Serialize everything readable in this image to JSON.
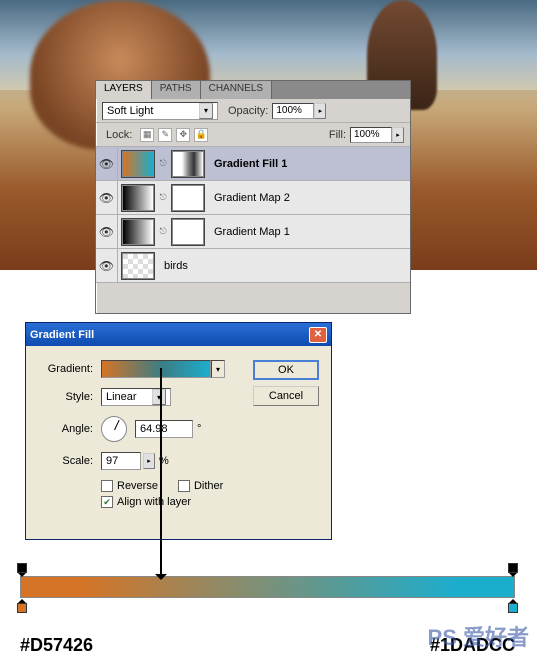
{
  "layers_panel": {
    "tabs": [
      "LAYERS",
      "PATHS",
      "CHANNELS"
    ],
    "active_tab": 0,
    "blend_mode": "Soft Light",
    "opacity_label": "Opacity:",
    "opacity_value": "100%",
    "lock_label": "Lock:",
    "fill_label": "Fill:",
    "fill_value": "100%",
    "layers": [
      {
        "name": "Gradient Fill 1",
        "selected": true,
        "bold": true,
        "thumb": "grad1",
        "mask": "mask-partial"
      },
      {
        "name": "Gradient Map 2",
        "selected": false,
        "bold": false,
        "thumb": "gradmap",
        "mask": "mask"
      },
      {
        "name": "Gradient Map 1",
        "selected": false,
        "bold": false,
        "thumb": "gradmap",
        "mask": "mask"
      },
      {
        "name": "birds",
        "selected": false,
        "bold": false,
        "thumb": "birds",
        "mask": null
      }
    ]
  },
  "gradient_fill": {
    "title": "Gradient Fill",
    "gradient_label": "Gradient:",
    "style_label": "Style:",
    "style_value": "Linear",
    "angle_label": "Angle:",
    "angle_value": "64.98",
    "angle_unit": "°",
    "scale_label": "Scale:",
    "scale_value": "97",
    "scale_unit": "%",
    "reverse_label": "Reverse",
    "dither_label": "Dither",
    "align_label": "Align with layer",
    "align_checked": true,
    "ok": "OK",
    "cancel": "Cancel"
  },
  "gradient_stops": {
    "left_hex": "#D57426",
    "right_hex": "#1DADCC"
  },
  "watermark": {
    "main": "PS 爱好者",
    "sub": ""
  }
}
